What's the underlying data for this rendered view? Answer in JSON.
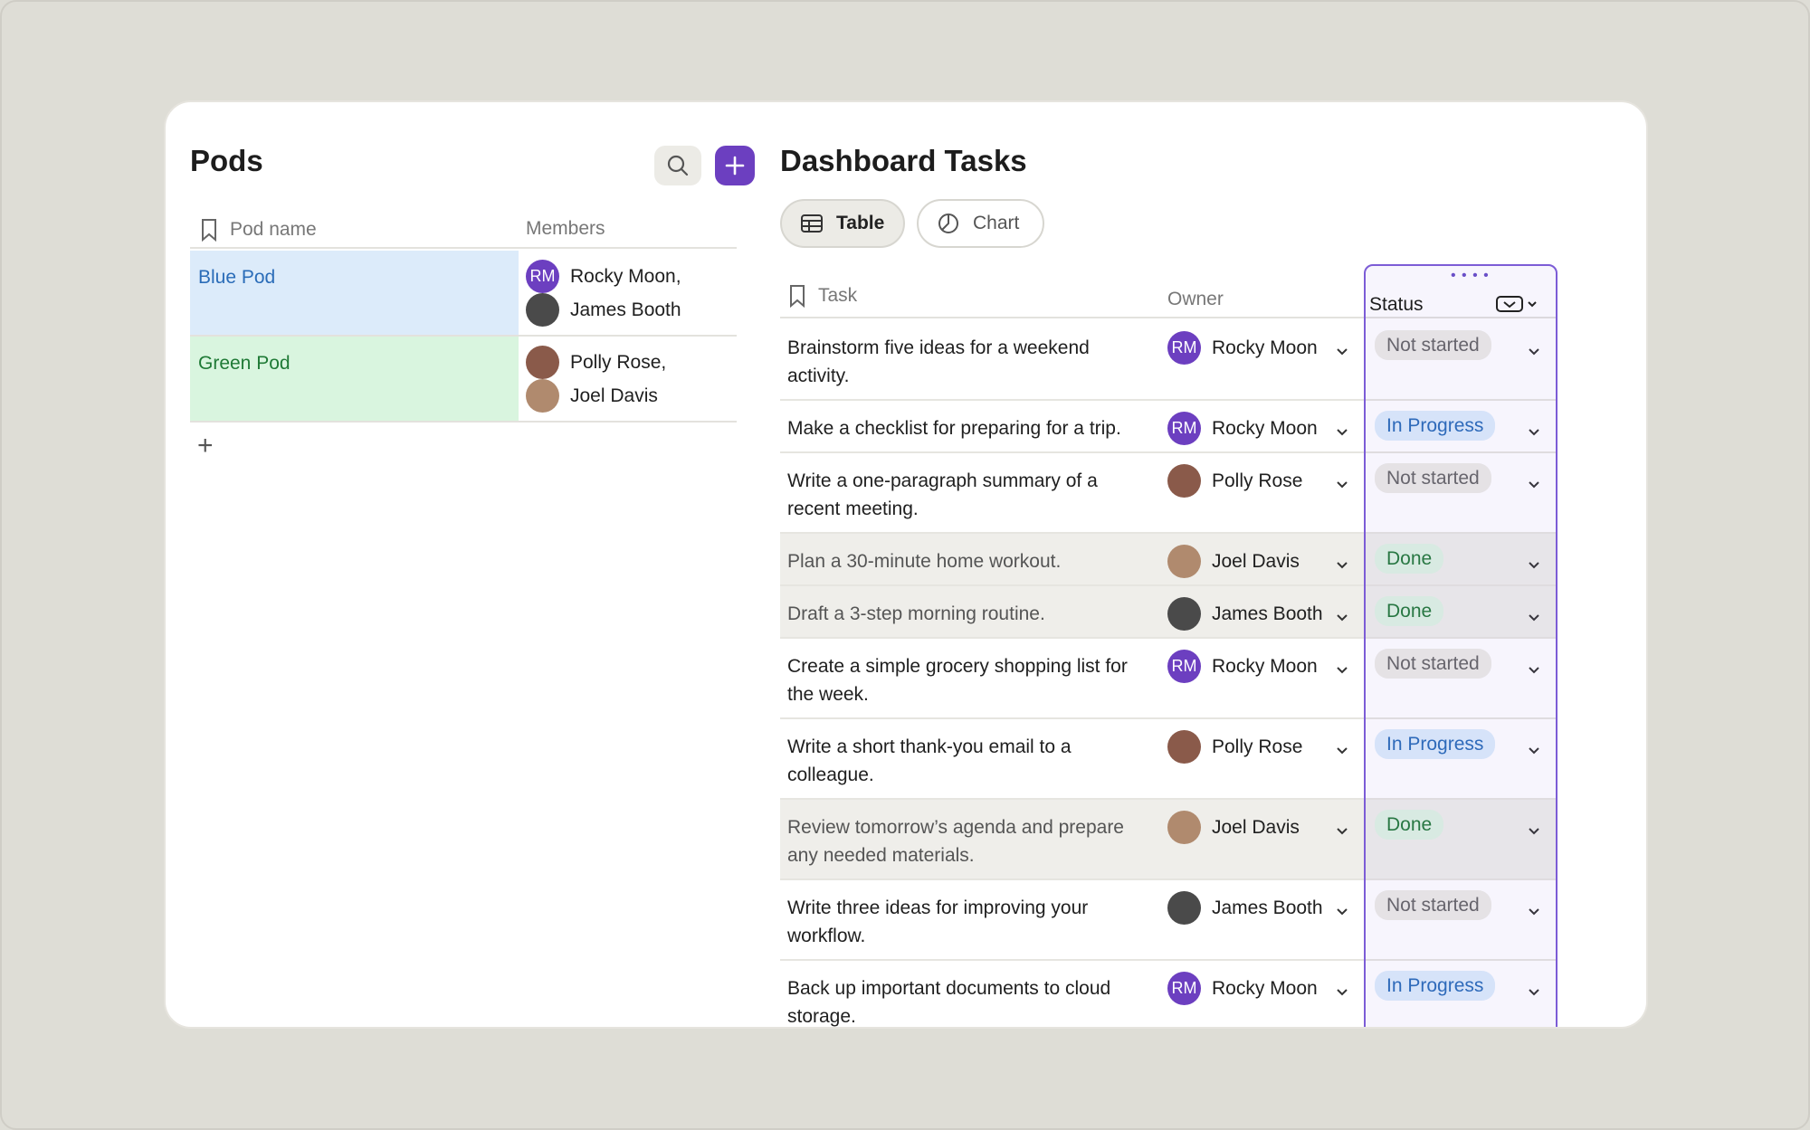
{
  "pods": {
    "title": "Pods",
    "columns": {
      "name": "Pod name",
      "members": "Members"
    },
    "rows": [
      {
        "name": "Blue Pod",
        "color": "#dcebfa",
        "text_color": "#2a6cb8",
        "members": [
          "Rocky Moon,",
          "James Booth"
        ]
      },
      {
        "name": "Green Pod",
        "color": "#d9f5df",
        "text_color": "#1f7a36",
        "members": [
          "Polly Rose,",
          "Joel Davis"
        ]
      }
    ],
    "add_row": "+"
  },
  "dashboard": {
    "title": "Dashboard Tasks",
    "tabs": {
      "table": "Table",
      "chart": "Chart"
    },
    "columns": {
      "task": "Task",
      "owner": "Owner",
      "status": "Status"
    },
    "rows": [
      {
        "task": "Brainstorm five ideas for a weekend activity.",
        "owner": "Rocky Moon",
        "avatar": "RM",
        "status": "Not started"
      },
      {
        "task": "Make a checklist for preparing for a trip.",
        "owner": "Rocky Moon",
        "avatar": "RM",
        "status": "In Progress"
      },
      {
        "task": "Write a one-paragraph summary of a recent meeting.",
        "owner": "Polly Rose",
        "avatar": "",
        "status": "Not started"
      },
      {
        "task": "Plan a 30-minute home workout.",
        "owner": "Joel Davis",
        "avatar": "",
        "status": "Done"
      },
      {
        "task": "Draft a 3-step morning routine.",
        "owner": "James Booth",
        "avatar": "",
        "status": "Done"
      },
      {
        "task": "Create a simple grocery shopping list for the week.",
        "owner": "Rocky Moon",
        "avatar": "RM",
        "status": "Not started"
      },
      {
        "task": "Write a short thank-you email to a colleague.",
        "owner": "Polly Rose",
        "avatar": "",
        "status": "In Progress"
      },
      {
        "task": "Review tomorrow’s agenda and prepare any needed materials.",
        "owner": "Joel Davis",
        "avatar": "",
        "status": "Done"
      },
      {
        "task": "Write three ideas for improving your workflow.",
        "owner": "James Booth",
        "avatar": "",
        "status": "Not started"
      },
      {
        "task": "Back up important documents to cloud storage.",
        "owner": "Rocky Moon",
        "avatar": "RM",
        "status": "In Progress"
      }
    ]
  },
  "avatar_initials": "RM",
  "colors": {
    "accent": "#6c3fc0",
    "status_border": "#7c5cd6"
  }
}
